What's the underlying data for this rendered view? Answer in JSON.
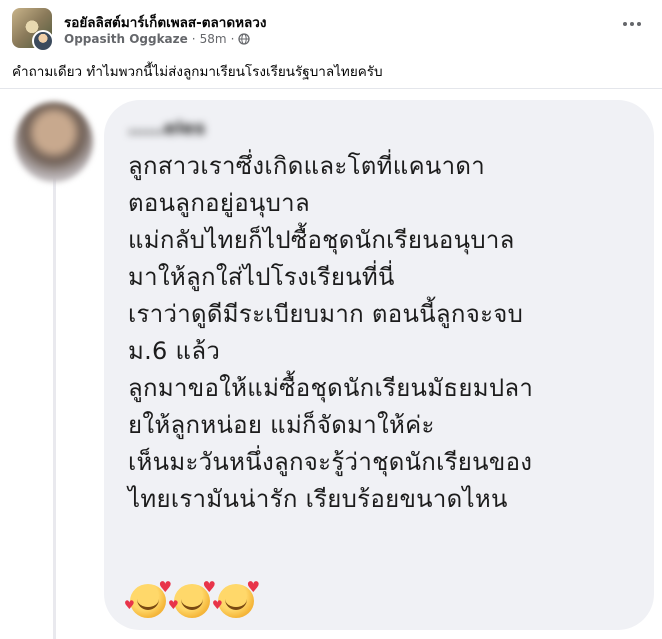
{
  "post": {
    "group_name": "รอยัลลิสต์มาร์เก็ตเพลส-ตลาดหลวง",
    "author": "Oppasith Oggkaze",
    "separator": "·",
    "time": "58m",
    "separator2": "·",
    "privacy_icon": "globe-icon",
    "more_icon": "more-horizontal-icon",
    "text": "คำถามเดียว ทำไมพวกนี้ไม่ส่งลูกมาเรียนโรงเรียนรัฐบาลไทยครับ"
  },
  "comment": {
    "commenter_name_partial": "……eles",
    "lines": [
      "ลูกสาวเราซึ่งเกิดและโตที่แคนาดา",
      "ตอนลูกอยู่อนุบาล",
      "แม่กลับไทยก็ไปซื้อชุดนักเรียนอนุบาล",
      "มาให้ลูกใส่ไปโรงเรียนที่นี่",
      "เราว่าดูดีมีระเบียบมาก  ตอนนี้ลูกจะจบ",
      "ม.6 แล้ว",
      "ลูกมาขอให้แม่ซื้อชุดนักเรียนมัธยมปลา",
      "ยให้ลูกหน่อย แม่ก็จัดมาให้ค่ะ",
      "เห็นมะวันหนึ่งลูกจะรู้ว่าชุดนักเรียนของ",
      "ไทยเรามันน่ารัก เรียบร้อยขนาดไหน"
    ],
    "emojis": [
      "smiling-face-with-hearts-icon",
      "smiling-face-with-hearts-icon",
      "smiling-face-with-hearts-icon"
    ]
  },
  "colors": {
    "bubble": "#f0f1f5",
    "meta_text": "#65676b",
    "heart": "#e8344a"
  }
}
